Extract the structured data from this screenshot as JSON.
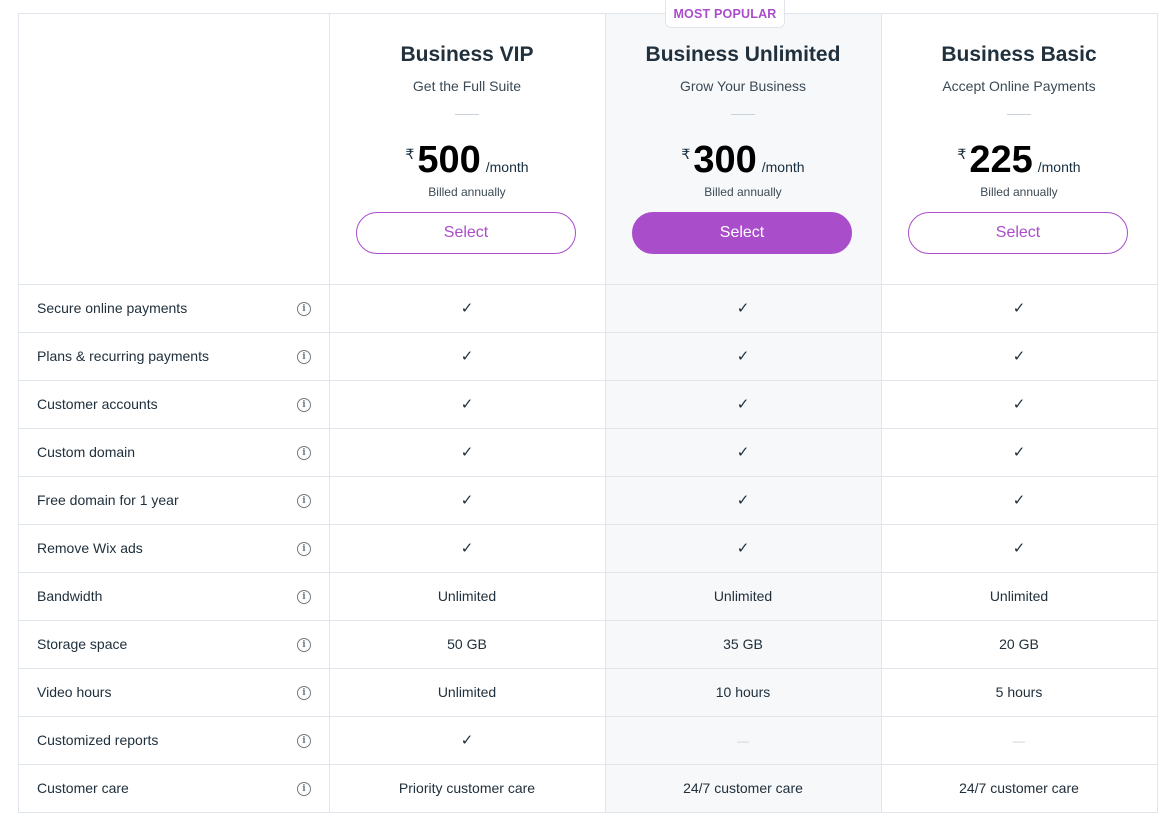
{
  "badge": "MOST POPULAR",
  "currency_symbol": "₹",
  "per_label": "/month",
  "billed_label": "Billed annually",
  "select_label": "Select",
  "plans": [
    {
      "name": "Business VIP",
      "subtitle": "Get the Full Suite",
      "price": "500"
    },
    {
      "name": "Business Unlimited",
      "subtitle": "Grow Your Business",
      "price": "300"
    },
    {
      "name": "Business Basic",
      "subtitle": "Accept Online Payments",
      "price": "225"
    }
  ],
  "features": [
    {
      "label": "Secure online payments",
      "values": [
        "check",
        "check",
        "check"
      ]
    },
    {
      "label": "Plans & recurring payments",
      "values": [
        "check",
        "check",
        "check"
      ]
    },
    {
      "label": "Customer accounts",
      "values": [
        "check",
        "check",
        "check"
      ]
    },
    {
      "label": "Custom domain",
      "values": [
        "check",
        "check",
        "check"
      ]
    },
    {
      "label": "Free domain for 1 year",
      "values": [
        "check",
        "check",
        "check"
      ]
    },
    {
      "label": "Remove Wix ads",
      "values": [
        "check",
        "check",
        "check"
      ]
    },
    {
      "label": "Bandwidth",
      "values": [
        "Unlimited",
        "Unlimited",
        "Unlimited"
      ]
    },
    {
      "label": "Storage space",
      "values": [
        "50 GB",
        "35 GB",
        "20 GB"
      ]
    },
    {
      "label": "Video hours",
      "values": [
        "Unlimited",
        "10 hours",
        "5 hours"
      ]
    },
    {
      "label": "Customized reports",
      "values": [
        "check",
        "dash",
        "dash"
      ]
    },
    {
      "label": "Customer care",
      "values": [
        "Priority customer care",
        "24/7 customer care",
        "24/7 customer care"
      ]
    }
  ],
  "glyphs": {
    "check": "✓",
    "dash": "—",
    "info": "i"
  },
  "colors": {
    "accent": "#a94dcb",
    "highlight_bg": "#f7f8fa",
    "border": "#dfe5eb"
  }
}
